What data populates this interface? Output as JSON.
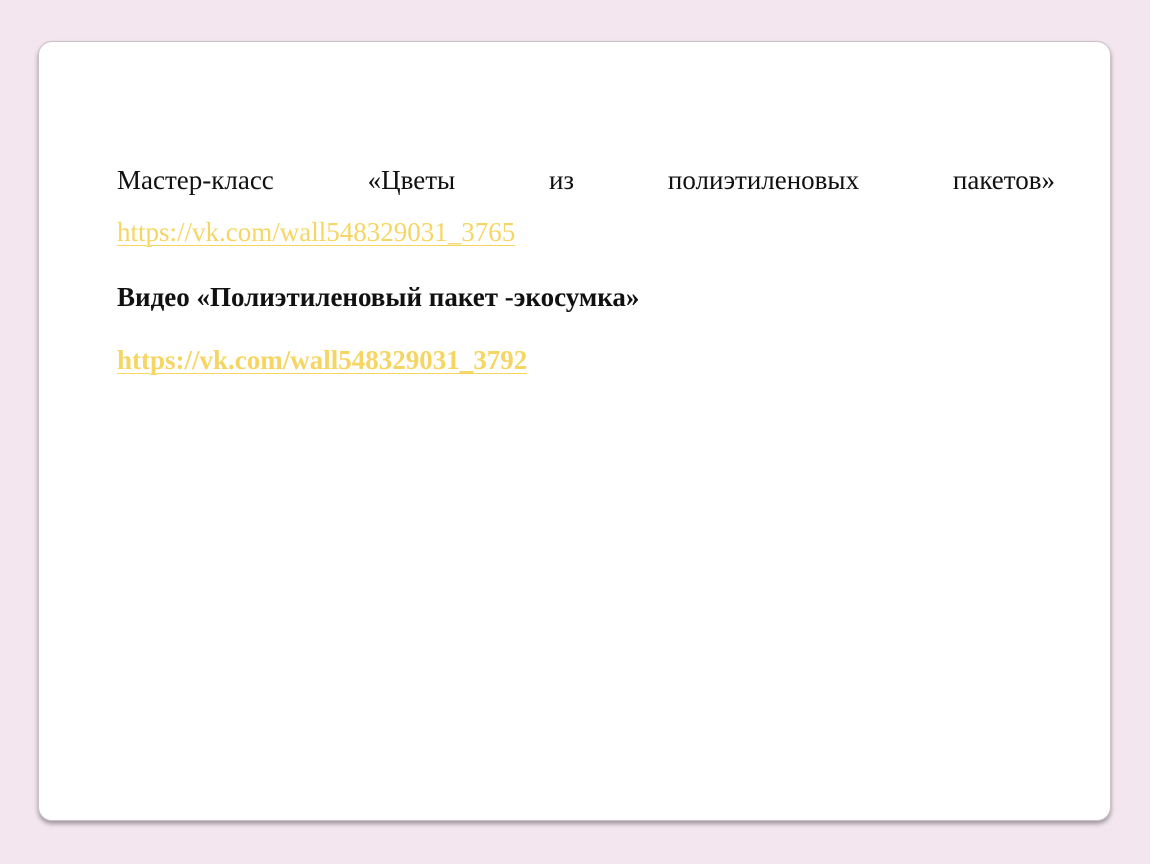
{
  "slide": {
    "masterclass_words": [
      "Мастер-класс",
      "«Цветы",
      "из",
      "полиэтиленовых",
      "пакетов»"
    ],
    "link1": "https://vk.com/wall548329031_3765",
    "video_heading": "Видео «Полиэтиленовый пакет -экосумка»",
    "link2": "https://vk.com/wall548329031_3792"
  },
  "colors": {
    "background": "#f4e6ee",
    "slide": "#ffffff",
    "text": "#111111",
    "link": "#f5d663"
  }
}
